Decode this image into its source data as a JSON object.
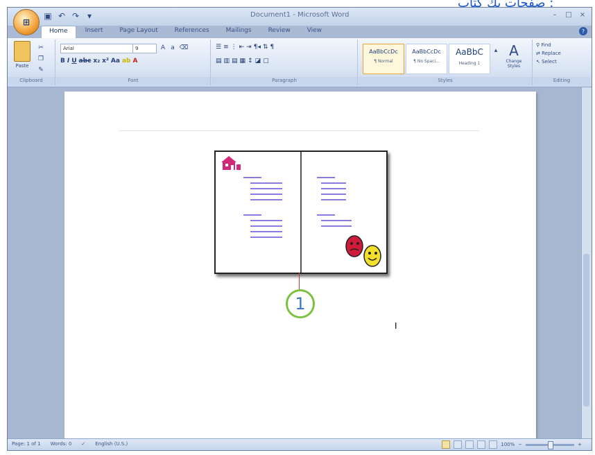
{
  "overlay_caption": "صفحات يك كتاب :",
  "window": {
    "title": "Document1 - Microsoft Word",
    "office_button_label": "Office",
    "qat": {
      "save": "save-icon",
      "undo": "undo-icon",
      "redo": "redo-icon"
    },
    "controls": {
      "minimize": "–",
      "maximize": "□",
      "close": "×"
    }
  },
  "ribbon": {
    "tabs": [
      "Home",
      "Insert",
      "Page Layout",
      "References",
      "Mailings",
      "Review",
      "View"
    ],
    "active_tab": "Home",
    "groups": {
      "clipboard": {
        "label": "Clipboard",
        "paste": "Paste"
      },
      "font": {
        "label": "Font",
        "font_name": "Arial",
        "font_size": "9"
      },
      "paragraph": {
        "label": "Paragraph"
      },
      "styles": {
        "label": "Styles",
        "items": [
          {
            "preview": "AaBbCcDc",
            "name": "¶ Normal"
          },
          {
            "preview": "AaBbCcDc",
            "name": "¶ No Spaci..."
          },
          {
            "preview": "AaBbC",
            "name": "Heading 1"
          }
        ],
        "change_styles": "Change Styles"
      },
      "editing": {
        "label": "Editing",
        "find": "Find",
        "replace": "Replace",
        "select": "Select"
      }
    }
  },
  "callout_number": "1",
  "status": {
    "page": "Page: 1 of 1",
    "words": "Words: 0",
    "language": "English (U.S.)",
    "zoom": "100%"
  }
}
